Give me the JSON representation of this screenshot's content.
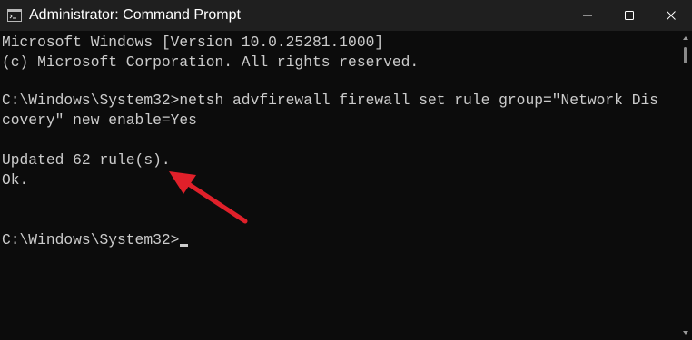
{
  "window": {
    "title": "Administrator: Command Prompt"
  },
  "console": {
    "lines": [
      "Microsoft Windows [Version 10.0.25281.1000]",
      "(c) Microsoft Corporation. All rights reserved.",
      "",
      "C:\\Windows\\System32>netsh advfirewall firewall set rule group=\"Network Dis",
      "covery\" new enable=Yes",
      "",
      "Updated 62 rule(s).",
      "Ok.",
      "",
      "",
      "C:\\Windows\\System32>"
    ]
  },
  "icons": {
    "app": "command-prompt-icon",
    "minimize": "minimize-icon",
    "maximize": "maximize-icon",
    "close": "close-icon",
    "annotation": "red-arrow"
  },
  "colors": {
    "titlebar": "#1f1f1f",
    "console_background": "#0c0c0c",
    "console_text": "#cccccc",
    "annotation_arrow": "#e0202a"
  }
}
